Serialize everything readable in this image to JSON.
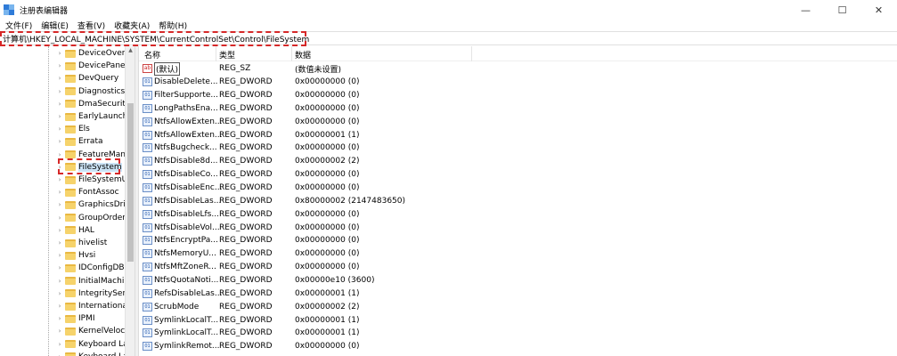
{
  "window": {
    "title": "注册表编辑器",
    "minimize_glyph": "—",
    "maximize_glyph": "☐",
    "close_glyph": "✕"
  },
  "menu": [
    "文件(F)",
    "编辑(E)",
    "查看(V)",
    "收藏夹(A)",
    "帮助(H)"
  ],
  "address": "计算机\\HKEY_LOCAL_MACHINE\\SYSTEM\\CurrentControlSet\\Control\\FileSystem",
  "tree": {
    "items": [
      {
        "label": "DeviceOverri",
        "selected": false
      },
      {
        "label": "DevicePanels",
        "selected": false
      },
      {
        "label": "DevQuery",
        "selected": false
      },
      {
        "label": "Diagnostics",
        "selected": false
      },
      {
        "label": "DmaSecurity",
        "selected": false
      },
      {
        "label": "EarlyLaunch",
        "selected": false
      },
      {
        "label": "Els",
        "selected": false
      },
      {
        "label": "Errata",
        "selected": false
      },
      {
        "label": "FeatureMana",
        "selected": false
      },
      {
        "label": "FileSystem",
        "selected": true
      },
      {
        "label": "FileSystemUti",
        "selected": false
      },
      {
        "label": "FontAssoc",
        "selected": false
      },
      {
        "label": "GraphicsDriv",
        "selected": false
      },
      {
        "label": "GroupOrderl",
        "selected": false
      },
      {
        "label": "HAL",
        "selected": false
      },
      {
        "label": "hivelist",
        "selected": false
      },
      {
        "label": "Hvsi",
        "selected": false
      },
      {
        "label": "IDConfigDB",
        "selected": false
      },
      {
        "label": "InitialMachin",
        "selected": false
      },
      {
        "label": "IntegrityServi",
        "selected": false
      },
      {
        "label": "International",
        "selected": false
      },
      {
        "label": "IPMI",
        "selected": false
      },
      {
        "label": "KernelVelocit",
        "selected": false
      },
      {
        "label": "Keyboard La",
        "selected": false
      },
      {
        "label": "Keyboard La",
        "selected": false
      }
    ]
  },
  "values": {
    "columns": {
      "name": "名称",
      "type": "类型",
      "data": "数据"
    },
    "rows": [
      {
        "icon": "ab",
        "name": "(默认)",
        "type": "REG_SZ",
        "data": "(数值未设置)"
      },
      {
        "icon": "01",
        "name": "DisableDelete...",
        "type": "REG_DWORD",
        "data": "0x00000000 (0)"
      },
      {
        "icon": "01",
        "name": "FilterSupporte...",
        "type": "REG_DWORD",
        "data": "0x00000000 (0)"
      },
      {
        "icon": "01",
        "name": "LongPathsEna...",
        "type": "REG_DWORD",
        "data": "0x00000000 (0)"
      },
      {
        "icon": "01",
        "name": "NtfsAllowExten...",
        "type": "REG_DWORD",
        "data": "0x00000000 (0)"
      },
      {
        "icon": "01",
        "name": "NtfsAllowExten...",
        "type": "REG_DWORD",
        "data": "0x00000001 (1)"
      },
      {
        "icon": "01",
        "name": "NtfsBugcheck...",
        "type": "REG_DWORD",
        "data": "0x00000000 (0)"
      },
      {
        "icon": "01",
        "name": "NtfsDisable8d...",
        "type": "REG_DWORD",
        "data": "0x00000002 (2)"
      },
      {
        "icon": "01",
        "name": "NtfsDisableCo...",
        "type": "REG_DWORD",
        "data": "0x00000000 (0)"
      },
      {
        "icon": "01",
        "name": "NtfsDisableEnc...",
        "type": "REG_DWORD",
        "data": "0x00000000 (0)"
      },
      {
        "icon": "01",
        "name": "NtfsDisableLas...",
        "type": "REG_DWORD",
        "data": "0x80000002 (2147483650)"
      },
      {
        "icon": "01",
        "name": "NtfsDisableLfs...",
        "type": "REG_DWORD",
        "data": "0x00000000 (0)"
      },
      {
        "icon": "01",
        "name": "NtfsDisableVol...",
        "type": "REG_DWORD",
        "data": "0x00000000 (0)"
      },
      {
        "icon": "01",
        "name": "NtfsEncryptPa...",
        "type": "REG_DWORD",
        "data": "0x00000000 (0)"
      },
      {
        "icon": "01",
        "name": "NtfsMemoryU...",
        "type": "REG_DWORD",
        "data": "0x00000000 (0)"
      },
      {
        "icon": "01",
        "name": "NtfsMftZoneR...",
        "type": "REG_DWORD",
        "data": "0x00000000 (0)"
      },
      {
        "icon": "01",
        "name": "NtfsQuotaNoti...",
        "type": "REG_DWORD",
        "data": "0x00000e10 (3600)"
      },
      {
        "icon": "01",
        "name": "RefsDisableLas...",
        "type": "REG_DWORD",
        "data": "0x00000001 (1)"
      },
      {
        "icon": "01",
        "name": "ScrubMode",
        "type": "REG_DWORD",
        "data": "0x00000002 (2)"
      },
      {
        "icon": "01",
        "name": "SymlinkLocalT...",
        "type": "REG_DWORD",
        "data": "0x00000001 (1)"
      },
      {
        "icon": "01",
        "name": "SymlinkLocalT...",
        "type": "REG_DWORD",
        "data": "0x00000001 (1)"
      },
      {
        "icon": "01",
        "name": "SymlinkRemot...",
        "type": "REG_DWORD",
        "data": "0x00000000 (0)"
      }
    ]
  }
}
